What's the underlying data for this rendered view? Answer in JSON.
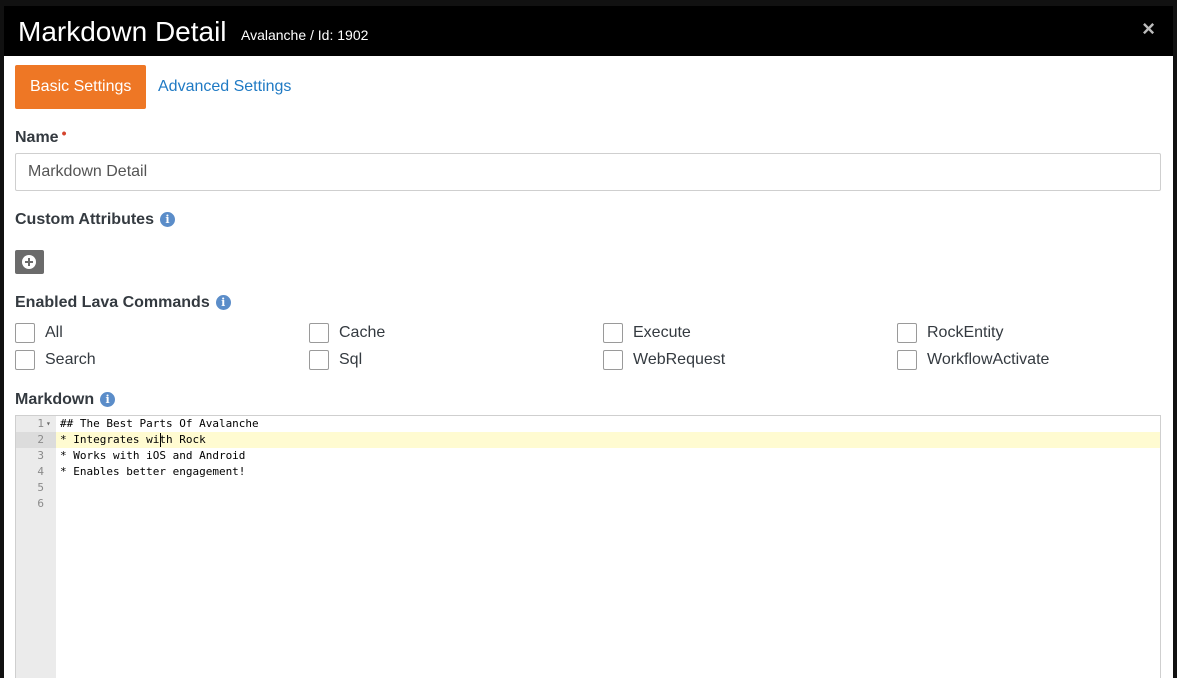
{
  "modal": {
    "title": "Markdown Detail",
    "subtitle": "Avalanche / Id: 1902",
    "close_label": "×"
  },
  "tabs": [
    {
      "label": "Basic Settings",
      "active": true
    },
    {
      "label": "Advanced Settings",
      "active": false
    }
  ],
  "name_field": {
    "label": "Name",
    "required_marker": "•",
    "value": "Markdown Detail"
  },
  "custom_attributes": {
    "label": "Custom Attributes",
    "info": "i"
  },
  "lava_commands": {
    "label": "Enabled Lava Commands",
    "info": "i",
    "options": [
      {
        "label": "All",
        "checked": false
      },
      {
        "label": "Cache",
        "checked": false
      },
      {
        "label": "Execute",
        "checked": false
      },
      {
        "label": "RockEntity",
        "checked": false
      },
      {
        "label": "Search",
        "checked": false
      },
      {
        "label": "Sql",
        "checked": false
      },
      {
        "label": "WebRequest",
        "checked": false
      },
      {
        "label": "WorkflowActivate",
        "checked": false
      }
    ]
  },
  "markdown": {
    "label": "Markdown",
    "info": "i",
    "line_numbers": [
      "1",
      "2",
      "3",
      "4",
      "5",
      "6"
    ],
    "lines": [
      "## The Best Parts Of Avalanche",
      "* Integrates with Rock",
      "* Works with iOS and Android",
      "* Enables better engagement!",
      "",
      ""
    ],
    "active_line": 2
  },
  "colors": {
    "accent": "#ee7725",
    "link": "#1f7ac4",
    "info": "#5b8dc9",
    "required": "#d4442e",
    "active_line": "#fffbd1"
  }
}
